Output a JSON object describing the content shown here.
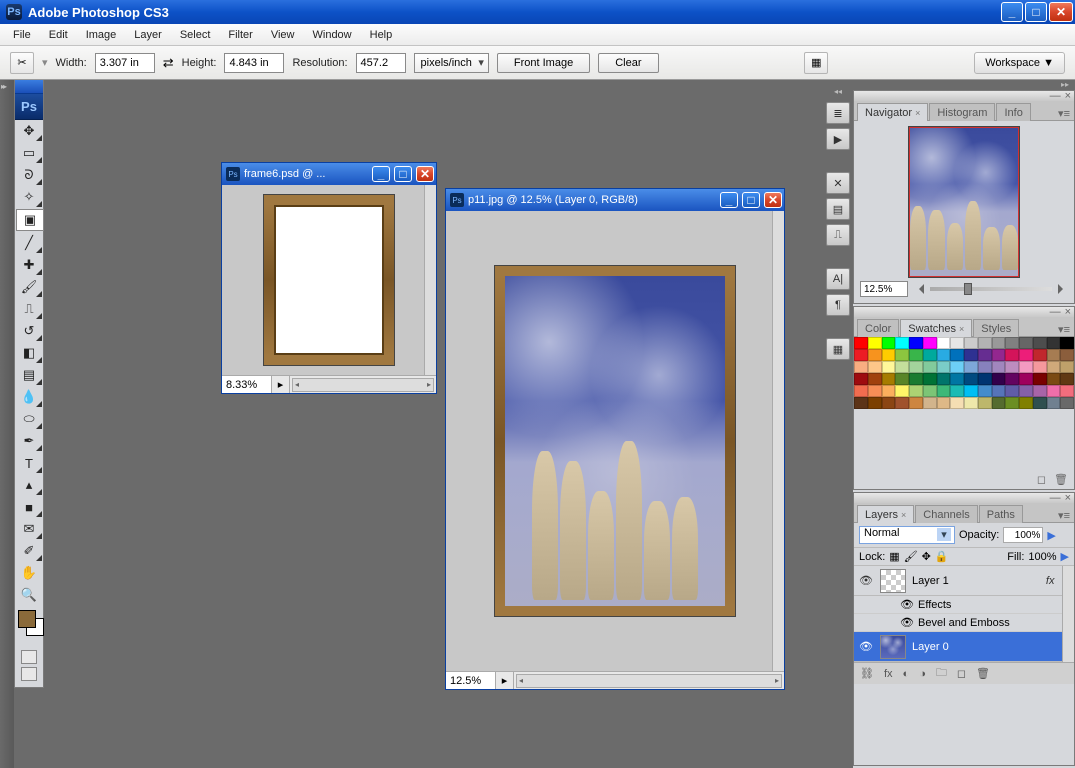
{
  "app": {
    "title": "Adobe Photoshop CS3"
  },
  "menu": [
    "File",
    "Edit",
    "Image",
    "Layer",
    "Select",
    "Filter",
    "View",
    "Window",
    "Help"
  ],
  "options": {
    "width_label": "Width:",
    "width_val": "3.307 in",
    "height_label": "Height:",
    "height_val": "4.843 in",
    "res_label": "Resolution:",
    "res_val": "457.2",
    "res_unit": "pixels/inch",
    "front": "Front Image",
    "clear": "Clear",
    "workspace": "Workspace ▼"
  },
  "doc1": {
    "title": "frame6.psd @ ...",
    "zoom": "8.33%"
  },
  "doc2": {
    "title": "p11.jpg @ 12.5% (Layer 0, RGB/8)",
    "zoom": "12.5%"
  },
  "nav": {
    "tabs": [
      "Navigator",
      "Histogram",
      "Info"
    ],
    "zoom": "12.5%"
  },
  "color": {
    "tabs": [
      "Color",
      "Swatches",
      "Styles"
    ]
  },
  "layers": {
    "tabs": [
      "Layers",
      "Channels",
      "Paths"
    ],
    "blend": "Normal",
    "opacity_label": "Opacity:",
    "opacity": "100%",
    "lock_label": "Lock:",
    "fill_label": "Fill:",
    "fill": "100%",
    "items": [
      {
        "name": "Layer 1",
        "fx": "fx"
      },
      {
        "sub": "Effects"
      },
      {
        "sub": "Bevel and Emboss"
      },
      {
        "name": "Layer 0",
        "active": true
      }
    ]
  },
  "swatches": [
    "#ff0000",
    "#ffff00",
    "#00ff00",
    "#00ffff",
    "#0000ff",
    "#ff00ff",
    "#ffffff",
    "#e6e6e6",
    "#cccccc",
    "#b3b3b3",
    "#999999",
    "#808080",
    "#666666",
    "#4d4d4d",
    "#333333",
    "#000000",
    "#ec1c24",
    "#f7931e",
    "#ffcc00",
    "#8cc63f",
    "#39b54a",
    "#00a99d",
    "#29abe2",
    "#0071bc",
    "#2e3192",
    "#662d91",
    "#93278f",
    "#d4145a",
    "#ed1e79",
    "#c1272d",
    "#a67c52",
    "#8b5e3c",
    "#f9ad81",
    "#fdc689",
    "#fff799",
    "#c4df9b",
    "#a3d39c",
    "#82ca9c",
    "#7accc8",
    "#6dcff6",
    "#7da7d9",
    "#8781bd",
    "#a186be",
    "#bd8cbf",
    "#f49ac1",
    "#f5989d",
    "#d0a97a",
    "#bfa16a",
    "#9e0b0f",
    "#a0410d",
    "#a67c00",
    "#598527",
    "#1a7b30",
    "#007236",
    "#00746b",
    "#0076a3",
    "#004a80",
    "#003471",
    "#32004b",
    "#630460",
    "#9e005d",
    "#790000",
    "#7b4a12",
    "#603913",
    "#f26c4f",
    "#f68e56",
    "#fbaf5d",
    "#fff568",
    "#acd373",
    "#7cc576",
    "#3cb878",
    "#1cbbb4",
    "#00bff3",
    "#448ccb",
    "#5674b9",
    "#605ca8",
    "#8560a8",
    "#a864a8",
    "#f06eaa",
    "#f26d7d",
    "#5c3317",
    "#7b3f00",
    "#8b4513",
    "#a0522d",
    "#cd853f",
    "#d2b48c",
    "#deb887",
    "#f5deb3",
    "#eee8aa",
    "#bdb76b",
    "#556b2f",
    "#6b8e23",
    "#808000",
    "#2f4f4f",
    "#708090",
    "#696969"
  ]
}
